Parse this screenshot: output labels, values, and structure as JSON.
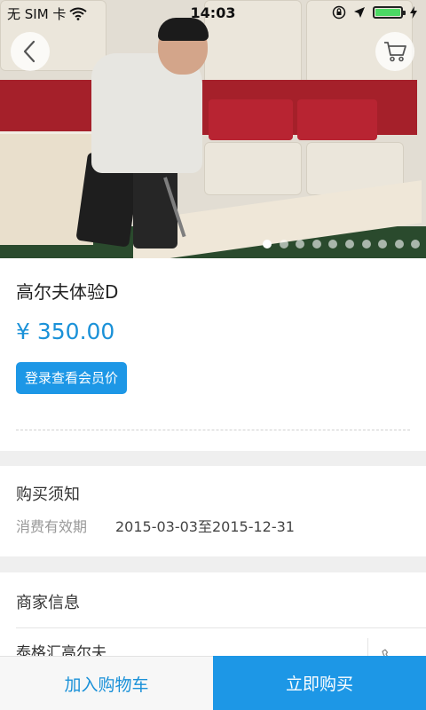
{
  "status_bar": {
    "carrier": "无 SIM 卡",
    "time": "14:03"
  },
  "hero": {
    "image_description": "",
    "carousel": {
      "count": 10,
      "active_index": 0
    }
  },
  "product": {
    "title": "高尔夫体验D",
    "price": "¥ 350.00",
    "member_price_button": "登录查看会员价"
  },
  "purchase_notice": {
    "title": "购买须知",
    "validity_label": "消费有效期",
    "validity_value": "2015-03-03至2015-12-31"
  },
  "merchant": {
    "title": "商家信息",
    "name": "泰格汇高尔夫"
  },
  "bottom_bar": {
    "add_to_cart": "加入购物车",
    "buy_now": "立即购买"
  },
  "colors": {
    "accent": "#1d97e6",
    "price": "#1a91d8"
  }
}
